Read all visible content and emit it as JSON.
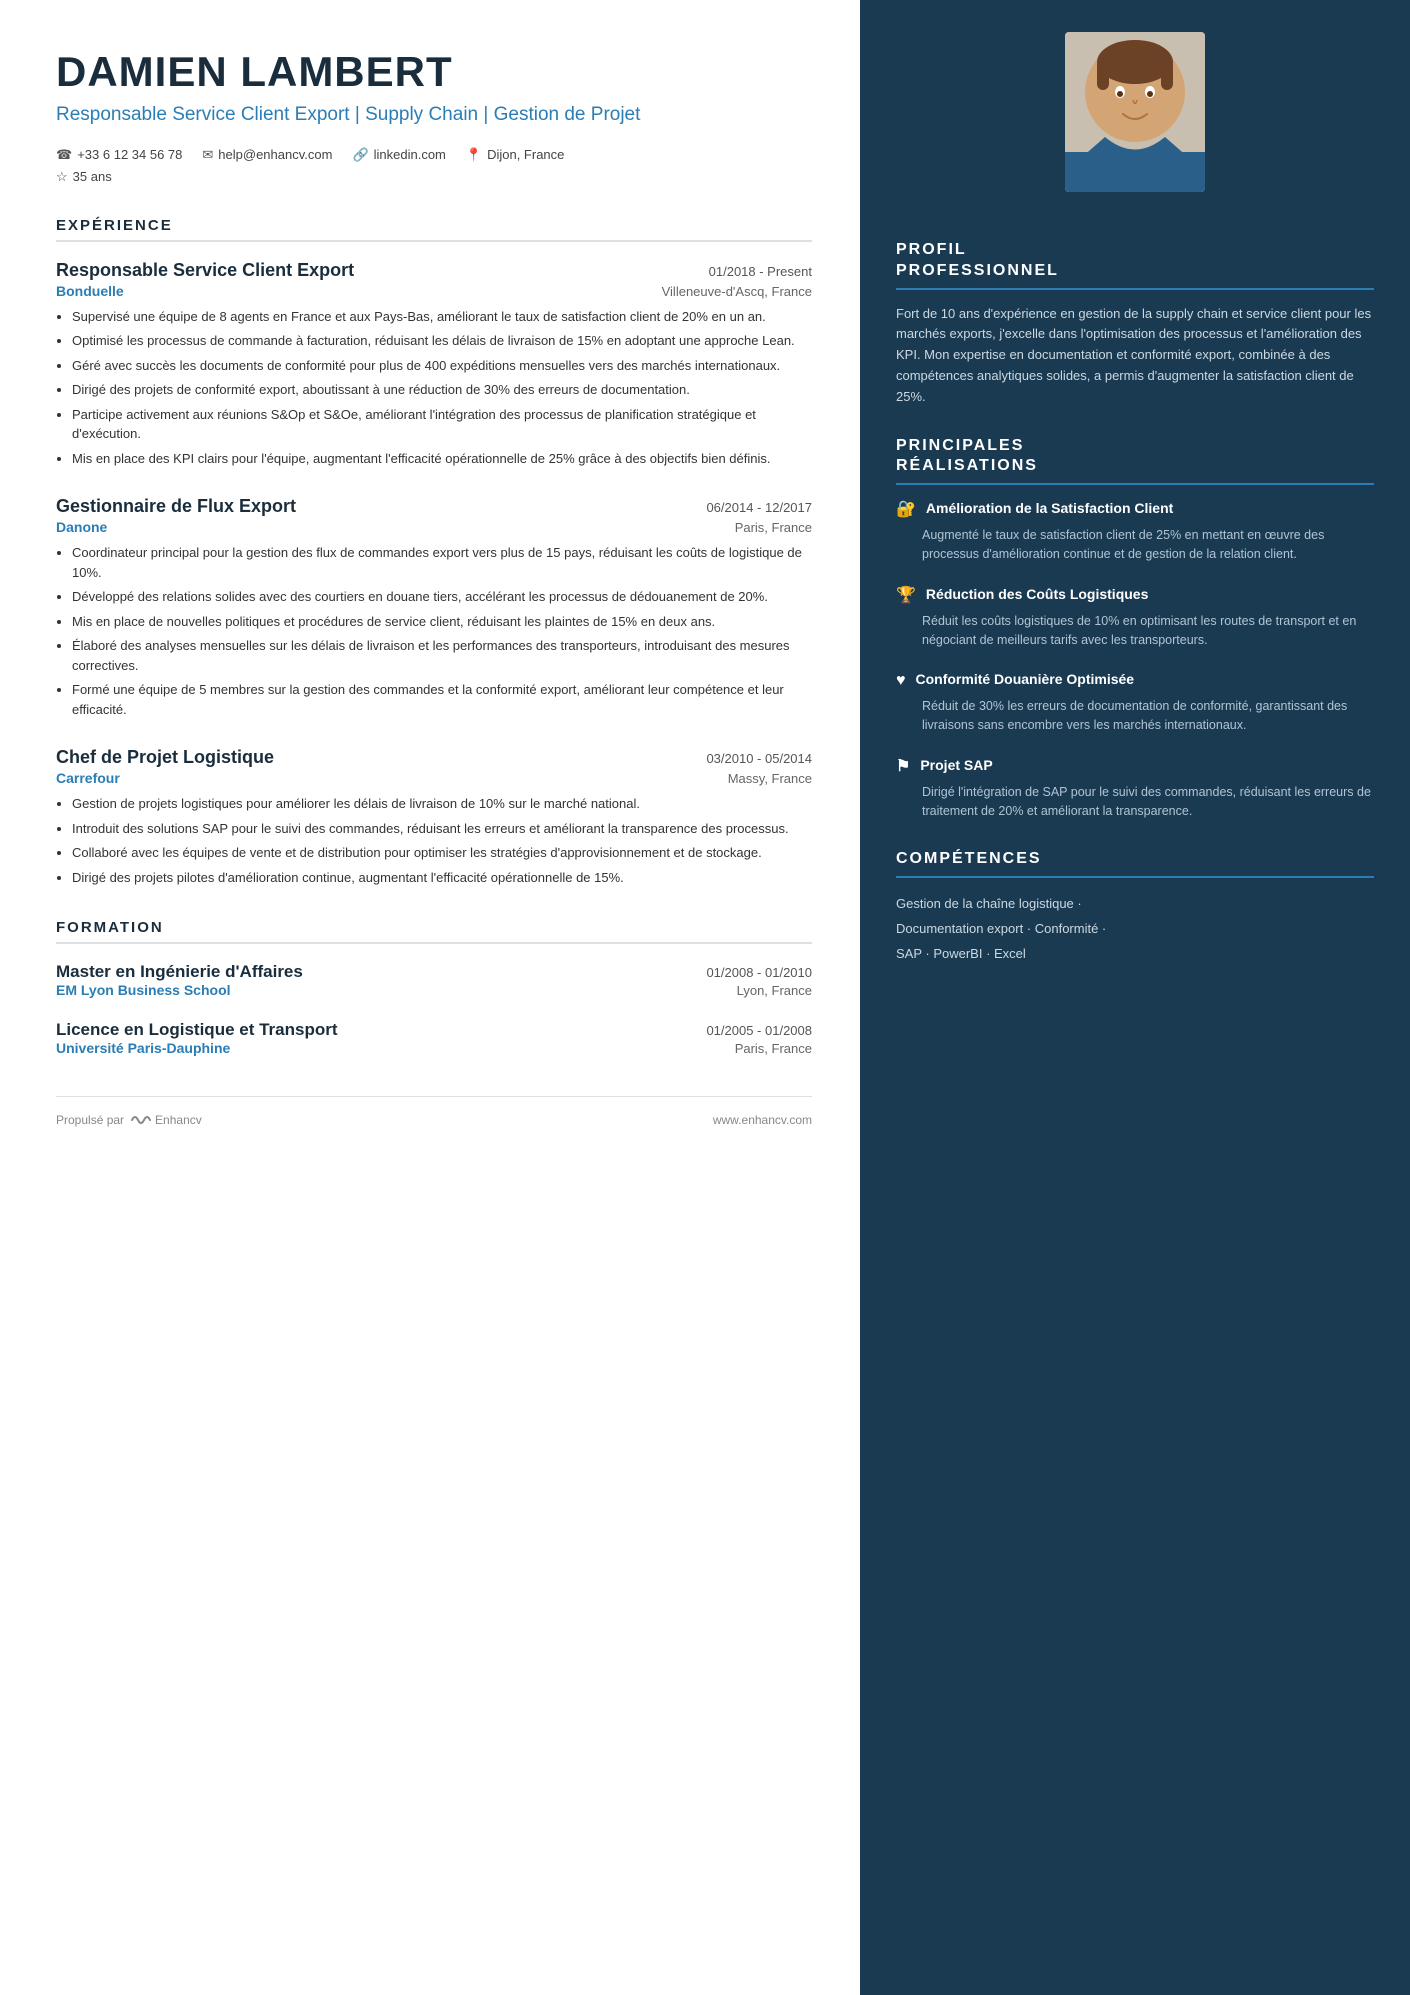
{
  "header": {
    "name": "DAMIEN LAMBERT",
    "title": "Responsable Service Client Export | Supply Chain | Gestion de Projet",
    "phone": "+33 6 12 34 56 78",
    "email": "help@enhancv.com",
    "linkedin": "linkedin.com",
    "location": "Dijon, France",
    "age": "35 ans"
  },
  "sections": {
    "experience_title": "EXPÉRIENCE",
    "formation_title": "FORMATION"
  },
  "experiences": [
    {
      "title": "Responsable Service Client Export",
      "date": "01/2018 - Present",
      "company": "Bonduelle",
      "location": "Villeneuve-d'Ascq, France",
      "bullets": [
        "Supervisé une équipe de 8 agents en France et aux Pays-Bas, améliorant le taux de satisfaction client de 20% en un an.",
        "Optimisé les processus de commande à facturation, réduisant les délais de livraison de 15% en adoptant une approche Lean.",
        "Géré avec succès les documents de conformité pour plus de 400 expéditions mensuelles vers des marchés internationaux.",
        "Dirigé des projets de conformité export, aboutissant à une réduction de 30% des erreurs de documentation.",
        "Participe activement aux réunions S&Op et S&Oe, améliorant l'intégration des processus de planification stratégique et d'exécution.",
        "Mis en place des KPI clairs pour l'équipe, augmentant l'efficacité opérationnelle de 25% grâce à des objectifs bien définis."
      ]
    },
    {
      "title": "Gestionnaire de Flux Export",
      "date": "06/2014 - 12/2017",
      "company": "Danone",
      "location": "Paris, France",
      "bullets": [
        "Coordinateur principal pour la gestion des flux de commandes export vers plus de 15 pays, réduisant les coûts de logistique de 10%.",
        "Développé des relations solides avec des courtiers en douane tiers, accélérant les processus de dédouanement de 20%.",
        "Mis en place de nouvelles politiques et procédures de service client, réduisant les plaintes de 15% en deux ans.",
        "Élaboré des analyses mensuelles sur les délais de livraison et les performances des transporteurs, introduisant des mesures correctives.",
        "Formé une équipe de 5 membres sur la gestion des commandes et la conformité export, améliorant leur compétence et leur efficacité."
      ]
    },
    {
      "title": "Chef de Projet Logistique",
      "date": "03/2010 - 05/2014",
      "company": "Carrefour",
      "location": "Massy, France",
      "bullets": [
        "Gestion de projets logistiques pour améliorer les délais de livraison de 10% sur le marché national.",
        "Introduit des solutions SAP pour le suivi des commandes, réduisant les erreurs et améliorant la transparence des processus.",
        "Collaboré avec les équipes de vente et de distribution pour optimiser les stratégies d'approvisionnement et de stockage.",
        "Dirigé des projets pilotes d'amélioration continue, augmentant l'efficacité opérationnelle de 15%."
      ]
    }
  ],
  "formation": [
    {
      "degree": "Master en Ingénierie d'Affaires",
      "date": "01/2008 - 01/2010",
      "school": "EM Lyon Business School",
      "location": "Lyon, France"
    },
    {
      "degree": "Licence en Logistique et Transport",
      "date": "01/2005 - 01/2008",
      "school": "Université Paris-Dauphine",
      "location": "Paris, France"
    }
  ],
  "footer": {
    "powered_by": "Propulsé par",
    "brand": "Enhancv",
    "website": "www.enhancv.com"
  },
  "right": {
    "profil_title": "PROFIL\nPROFESSIONNEL",
    "profil_text": "Fort de 10 ans d'expérience en gestion de la supply chain et service client pour les marchés exports, j'excelle dans l'optimisation des processus et l'amélioration des KPI. Mon expertise en documentation et conformité export, combinée à des compétences analytiques solides, a permis d'augmenter la satisfaction client de 25%.",
    "realisations_title": "PRINCIPALES\nRÉALISATIONS",
    "realisations": [
      {
        "icon": "🔒",
        "title": "Amélioration de la Satisfaction Client",
        "desc": "Augmenté le taux de satisfaction client de 25% en mettant en œuvre des processus d'amélioration continue et de gestion de la relation client."
      },
      {
        "icon": "🏆",
        "title": "Réduction des Coûts Logistiques",
        "desc": "Réduit les coûts logistiques de 10% en optimisant les routes de transport et en négociant de meilleurs tarifs avec les transporteurs."
      },
      {
        "icon": "♥",
        "title": "Conformité Douanière Optimisée",
        "desc": "Réduit de 30% les erreurs de documentation de conformité, garantissant des livraisons sans encombre vers les marchés internationaux."
      },
      {
        "icon": "⚑",
        "title": "Projet SAP",
        "desc": "Dirigé l'intégration de SAP pour le suivi des commandes, réduisant les erreurs de traitement de 20% et améliorant la transparence."
      }
    ],
    "competences_title": "COMPÉTENCES",
    "competences": [
      "Gestion de la chaîne logistique ·",
      "Documentation export · Conformité ·",
      "SAP · PowerBI · Excel"
    ]
  }
}
